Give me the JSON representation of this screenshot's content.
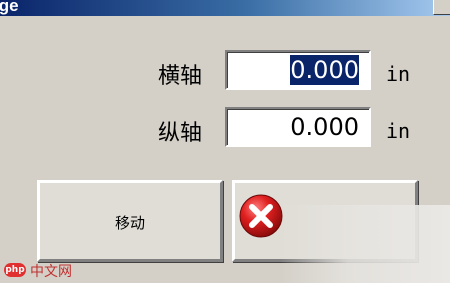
{
  "window": {
    "title": "lge"
  },
  "fields": {
    "horizontal": {
      "label": "横轴",
      "value": "0.000",
      "unit": "in"
    },
    "vertical": {
      "label": "纵轴",
      "value": "0.000",
      "unit": "in"
    }
  },
  "buttons": {
    "move_label": "移动",
    "cancel_icon": "close-icon"
  },
  "watermark": {
    "logo": "php",
    "text": "中文网"
  },
  "colors": {
    "dialog_bg": "#d4d0c8",
    "selection": "#0a246a",
    "cancel_red": "#d42020"
  }
}
